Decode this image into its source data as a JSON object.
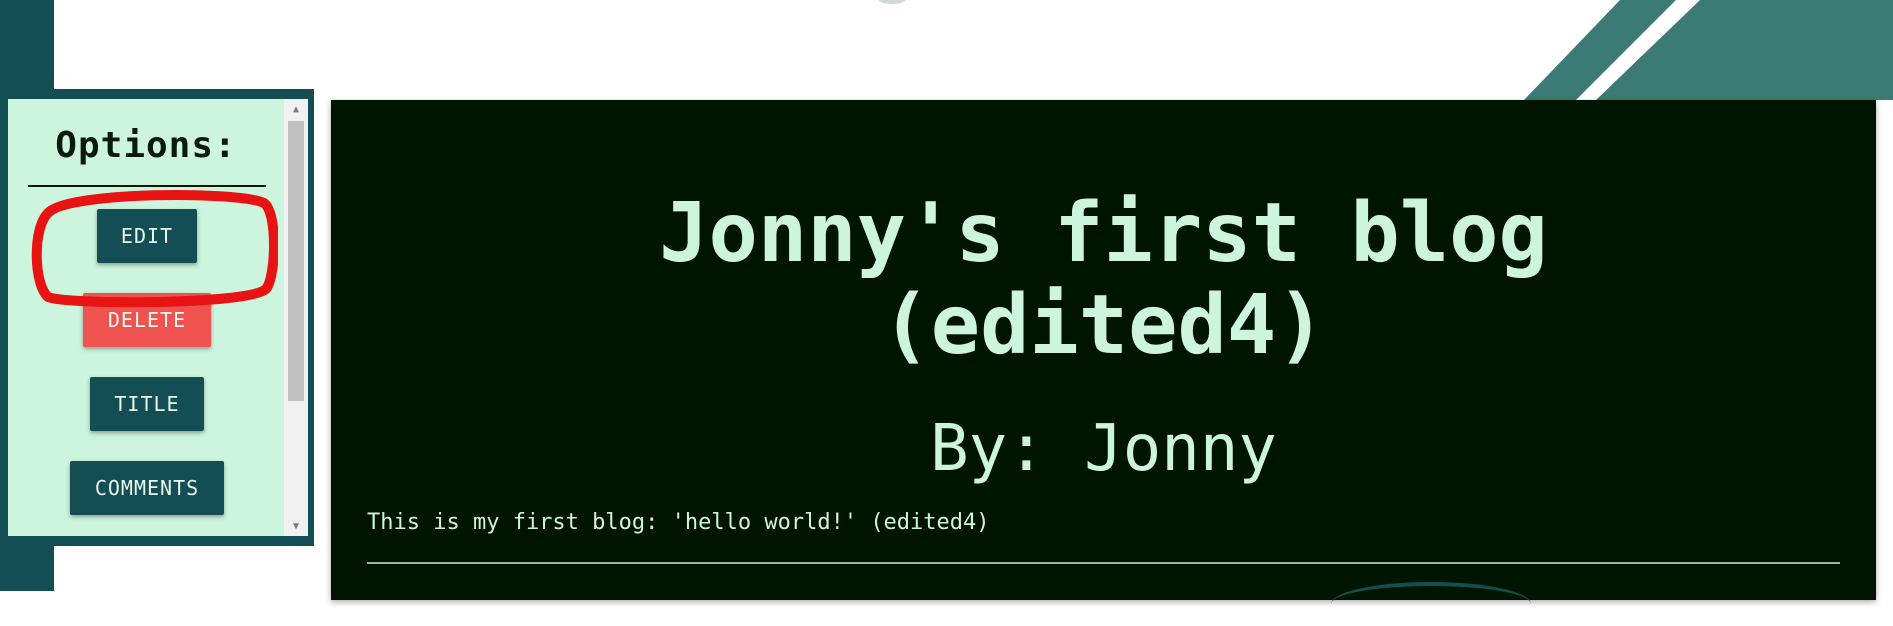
{
  "options": {
    "title": "Options:",
    "buttons": {
      "edit": "EDIT",
      "delete": "DELETE",
      "title": "TITLE",
      "comments": "COMMENTS"
    }
  },
  "blog": {
    "title_line1": "Jonny's first blog",
    "title_line2": "(edited4)",
    "author": "By: Jonny",
    "body": "This is my first blog: 'hello world!' (edited4)"
  },
  "colors": {
    "dark_teal": "#134e54",
    "mint": "#cdf5de",
    "card_bg": "#001500",
    "delete_red": "#ef5350",
    "highlight_red": "#e81414"
  }
}
